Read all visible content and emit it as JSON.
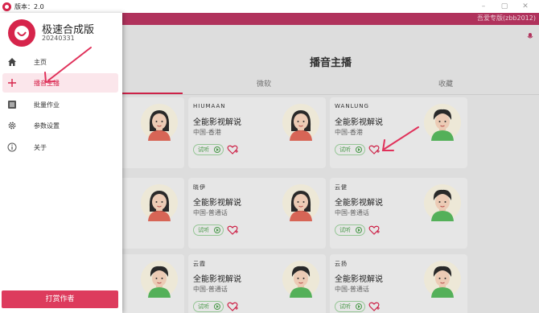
{
  "window": {
    "version_label": "版本：2.0",
    "controls": [
      "–",
      "▢",
      "✕"
    ]
  },
  "header": {
    "user_label": "吾爱专版(zbb2012)"
  },
  "sidebar": {
    "app_name": "极速合成版",
    "app_version": "20240331",
    "items": [
      {
        "label": "主页",
        "icon": "home-icon"
      },
      {
        "label": "播音主播",
        "icon": "plus-icon"
      },
      {
        "label": "批量作业",
        "icon": "list-icon"
      },
      {
        "label": "参数设置",
        "icon": "gear-icon"
      },
      {
        "label": "关于",
        "icon": "info-icon"
      }
    ],
    "reward_label": "打赏作者"
  },
  "main": {
    "title": "播音主播",
    "tabs": [
      "微软",
      "收藏"
    ],
    "cards": [
      {
        "name": "",
        "title": "",
        "region": "",
        "try_label": ""
      },
      {
        "name": "HIUMAAN",
        "title": "全能影视解说",
        "region": "中国-香港",
        "try_label": "试听"
      },
      {
        "name": "WANLUNG",
        "title": "全能影视解说",
        "region": "中国-香港",
        "try_label": "试听"
      },
      {
        "name": "",
        "title": "",
        "region": "",
        "try_label": ""
      },
      {
        "name": "晓伊",
        "title": "全能影视解说",
        "region": "中国-普通话",
        "try_label": "试听"
      },
      {
        "name": "云健",
        "title": "全能影视解说",
        "region": "中国-普通话",
        "try_label": "试听"
      },
      {
        "name": "",
        "title": "",
        "region": "",
        "try_label": ""
      },
      {
        "name": "云霞",
        "title": "全能影视解说",
        "region": "中国-普通话",
        "try_label": "试听"
      },
      {
        "name": "云扬",
        "title": "全能影视解说",
        "region": "中国-普通话",
        "try_label": "试听"
      }
    ]
  },
  "colors": {
    "accent": "#d6244b",
    "header": "#b83560",
    "try_green": "#4b9f4b",
    "arrow": "#e0315a"
  }
}
